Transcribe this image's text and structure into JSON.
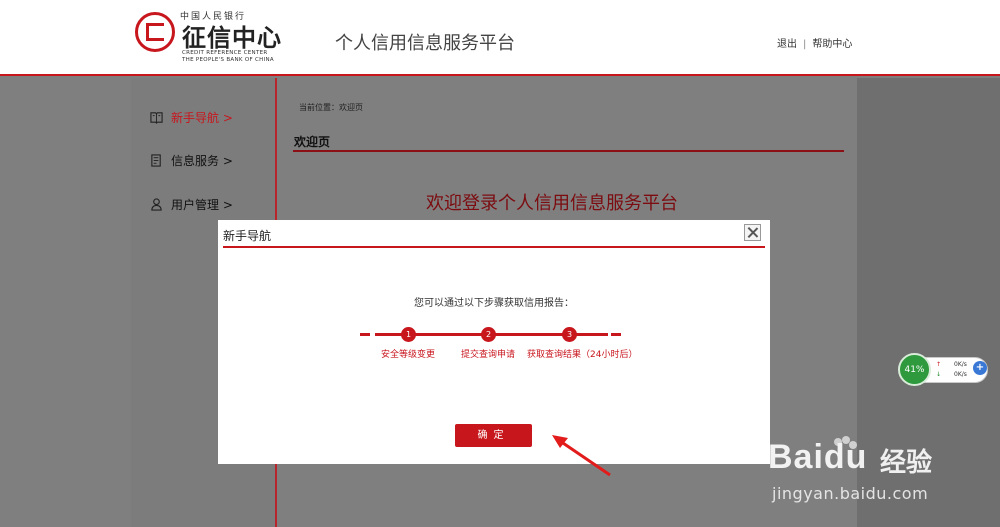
{
  "header": {
    "logo_topline": "中国人民银行",
    "logo_name": "征信中心",
    "logo_en_line1": "CREDIT REFERENCE CENTER",
    "logo_en_line2": "THE PEOPLE'S BANK OF CHINA",
    "platform_title": "个人信用信息服务平台",
    "logout_label": "退出",
    "separator": "|",
    "help_label": "帮助中心"
  },
  "sidebar": {
    "items": [
      {
        "label": "新手导航 >",
        "icon": "book-icon",
        "active": true
      },
      {
        "label": "信息服务 >",
        "icon": "document-icon",
        "active": false
      },
      {
        "label": "用户管理 >",
        "icon": "user-icon",
        "active": false
      }
    ]
  },
  "main": {
    "breadcrumb": "当前位置：欢迎页",
    "heading": "欢迎页",
    "welcome_text": "欢迎登录个人信用信息服务平台"
  },
  "modal": {
    "title": "新手导航",
    "intro": "您可以通过以下步骤获取信用报告：",
    "steps": [
      {
        "number": "1",
        "label": "安全等级变更"
      },
      {
        "number": "2",
        "label": "提交查询申请"
      },
      {
        "number": "3",
        "label": "获取查询结果（24小时后）"
      }
    ],
    "confirm_label": "确定"
  },
  "net_widget": {
    "percent": "41%",
    "upload_speed": "0K/s",
    "download_speed": "0K/s",
    "plus_label": "+"
  },
  "watermark": {
    "brand": "Baidu",
    "brand_cn": "经验",
    "url": "jingyan.baidu.com"
  },
  "colors": {
    "accent": "#c8161d",
    "overlay": "#7f7f7f"
  }
}
